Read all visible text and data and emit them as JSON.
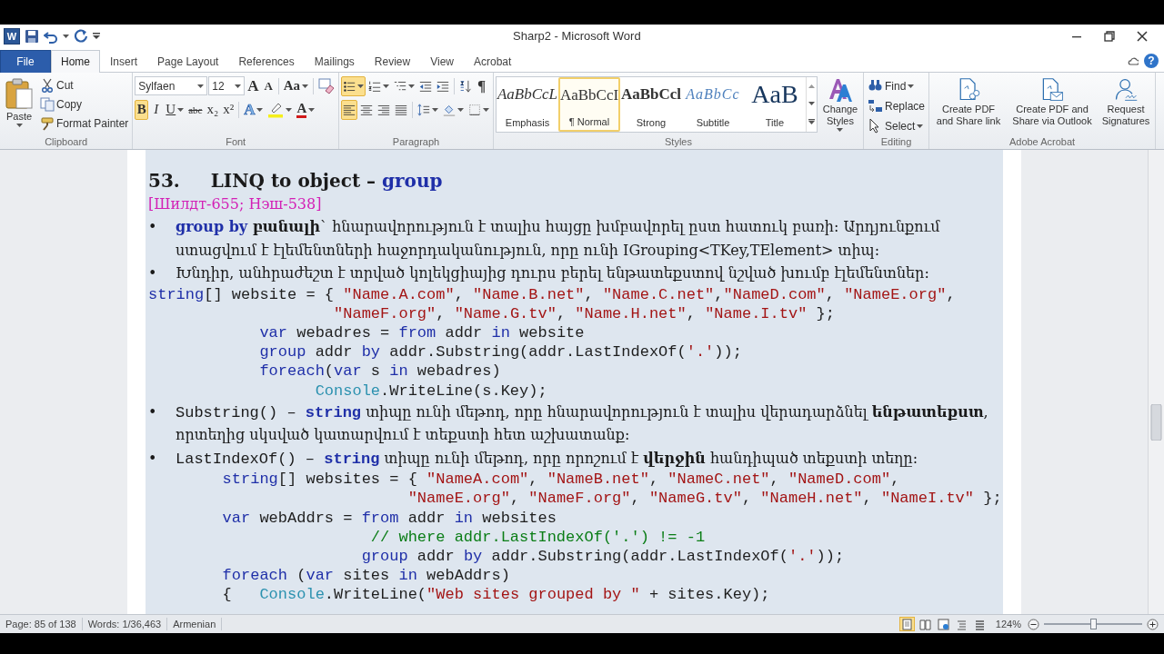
{
  "window": {
    "title": "Sharp2 - Microsoft Word",
    "app_icon_letter": "W",
    "help": "?"
  },
  "tabs": [
    {
      "label": "File",
      "kind": "file",
      "selected": false
    },
    {
      "label": "Home",
      "kind": "tab",
      "selected": true
    },
    {
      "label": "Insert",
      "kind": "tab",
      "selected": false
    },
    {
      "label": "Page Layout",
      "kind": "tab",
      "selected": false
    },
    {
      "label": "References",
      "kind": "tab",
      "selected": false
    },
    {
      "label": "Mailings",
      "kind": "tab",
      "selected": false
    },
    {
      "label": "Review",
      "kind": "tab",
      "selected": false
    },
    {
      "label": "View",
      "kind": "tab",
      "selected": false
    },
    {
      "label": "Acrobat",
      "kind": "tab",
      "selected": false
    }
  ],
  "ribbon": {
    "clipboard": {
      "label": "Clipboard",
      "paste": "Paste",
      "items": [
        {
          "label": "Cut",
          "kind": "cut"
        },
        {
          "label": "Copy",
          "kind": "copy"
        },
        {
          "label": "Format Painter",
          "kind": "painter"
        }
      ]
    },
    "font": {
      "label": "Font",
      "font_name": "Sylfaen",
      "font_size": "12",
      "grow": "A",
      "shrink": "A",
      "change_case": "Aa",
      "buttons": [
        {
          "label": "B",
          "kind": "bold",
          "on": true
        },
        {
          "label": "I",
          "kind": "italic",
          "on": false
        },
        {
          "label": "U",
          "kind": "underline",
          "on": false
        },
        {
          "label": "abc",
          "kind": "strike",
          "on": false
        },
        {
          "label": "x₂",
          "kind": "sub",
          "on": false
        },
        {
          "label": "x²",
          "kind": "sup",
          "on": false
        }
      ],
      "text_effects": "A",
      "font_color": "A"
    },
    "paragraph": {
      "label": "Paragraph",
      "rows": [
        [
          {
            "kind": "bullets",
            "on": true
          },
          {
            "kind": "numbering",
            "on": false
          },
          {
            "kind": "multilevel",
            "on": false
          },
          {
            "kind": "indent-decrease",
            "on": false
          },
          {
            "kind": "indent-increase",
            "on": false
          },
          {
            "kind": "sort",
            "on": false
          },
          {
            "kind": "marks",
            "label": "¶",
            "on": false
          }
        ],
        [
          {
            "kind": "align-left",
            "on": true
          },
          {
            "kind": "align-center",
            "on": false
          },
          {
            "kind": "align-right",
            "on": false
          },
          {
            "kind": "justify",
            "on": false
          },
          {
            "kind": "line-spacing",
            "on": false
          },
          {
            "kind": "shading",
            "on": false
          },
          {
            "kind": "borders",
            "on": false
          }
        ]
      ]
    },
    "styles": {
      "label": "Styles",
      "change_styles": "Change Styles",
      "gallery": [
        {
          "sample": "AaBbCcL",
          "name": "Emphasis",
          "kind": "emphasis",
          "selected": false
        },
        {
          "sample": "AaBbCcI",
          "name": "¶ Normal",
          "kind": "normal",
          "selected": true
        },
        {
          "sample": "AaBbCcl",
          "name": "Strong",
          "kind": "strong",
          "selected": false
        },
        {
          "sample": "AaBbCc",
          "name": "Subtitle",
          "kind": "subtitle",
          "selected": false
        },
        {
          "sample": "AaB",
          "name": "Title",
          "kind": "title",
          "selected": false
        }
      ]
    },
    "editing": {
      "label": "Editing",
      "items": [
        {
          "label": "Find",
          "kind": "find"
        },
        {
          "label": "Replace",
          "kind": "replace"
        },
        {
          "label": "Select",
          "kind": "select"
        }
      ]
    },
    "acrobat": {
      "label": "Adobe Acrobat",
      "items": [
        {
          "label": "Create PDF and Share link",
          "kind": "share-link"
        },
        {
          "label": "Create PDF and Share via Outlook",
          "kind": "share-mail"
        },
        {
          "label": "Request Signatures",
          "kind": "signature"
        }
      ]
    }
  },
  "document": {
    "heading": {
      "number": "53.",
      "segments": [
        {
          "text": "LINQ  to object – ",
          "kind": "plain"
        },
        {
          "text": "group",
          "kind": "keyword"
        }
      ]
    },
    "reference": "[Шилдт-655; Нэш-538]",
    "blocks": [
      {
        "kind": "bullet",
        "bullet": "•",
        "segments": [
          {
            "text": "group  by",
            "kind": "keyword"
          },
          {
            "text": " բանալի",
            "kind": "bold"
          },
          {
            "text": "` հնարավորություն է տալիս հայցը խմբավորել ըստ հատուկ բառի։ Արդյունքում ստացվում է էլեմենտների հաջորդականություն, որը ունի IGrouping<TKey,TElement> տիպ։",
            "kind": "plain"
          }
        ]
      },
      {
        "kind": "bullet",
        "bullet": "•",
        "segments": [
          {
            "text": "Խնդիր, անհրաժեշտ է տրված կոլեկցիայից դուրս բերել ենթատեքստով նշված խումբ էլեմենտներ։",
            "kind": "plain"
          }
        ]
      },
      {
        "kind": "code",
        "lines": [
          [
            {
              "text": "string",
              "kind": "keyword"
            },
            {
              "text": "[] website = { ",
              "kind": "plain"
            },
            {
              "text": "\"Name.A.com\"",
              "kind": "string"
            },
            {
              "text": ", ",
              "kind": "plain"
            },
            {
              "text": "\"Name.B.net\"",
              "kind": "string"
            },
            {
              "text": ", ",
              "kind": "plain"
            },
            {
              "text": "\"Name.C.net\"",
              "kind": "string"
            },
            {
              "text": ",",
              "kind": "plain"
            },
            {
              "text": "\"NameD.com\"",
              "kind": "string"
            },
            {
              "text": ", ",
              "kind": "plain"
            },
            {
              "text": "\"NameE.org\"",
              "kind": "string"
            },
            {
              "text": ",",
              "kind": "plain"
            }
          ],
          [
            {
              "text": "                    \"NameF.org\"",
              "kind": "string"
            },
            {
              "text": ", ",
              "kind": "plain"
            },
            {
              "text": "\"Name.G.tv\"",
              "kind": "string"
            },
            {
              "text": ", ",
              "kind": "plain"
            },
            {
              "text": "\"Name.H.net\"",
              "kind": "string"
            },
            {
              "text": ", ",
              "kind": "plain"
            },
            {
              "text": "\"Name.I.tv\"",
              "kind": "string"
            },
            {
              "text": " };",
              "kind": "plain"
            }
          ],
          [
            {
              "text": "            var",
              "kind": "keyword"
            },
            {
              "text": " webadres = ",
              "kind": "plain"
            },
            {
              "text": "from",
              "kind": "keyword"
            },
            {
              "text": " addr ",
              "kind": "plain"
            },
            {
              "text": "in",
              "kind": "keyword"
            },
            {
              "text": " website",
              "kind": "plain"
            }
          ],
          [
            {
              "text": "            group",
              "kind": "keyword"
            },
            {
              "text": " addr ",
              "kind": "plain"
            },
            {
              "text": "by",
              "kind": "keyword"
            },
            {
              "text": " addr.Substring(addr.LastIndexOf(",
              "kind": "plain"
            },
            {
              "text": "'.'",
              "kind": "string"
            },
            {
              "text": "));",
              "kind": "plain"
            }
          ],
          [
            {
              "text": "            foreach",
              "kind": "keyword"
            },
            {
              "text": "(",
              "kind": "plain"
            },
            {
              "text": "var",
              "kind": "keyword"
            },
            {
              "text": " s ",
              "kind": "plain"
            },
            {
              "text": "in",
              "kind": "keyword"
            },
            {
              "text": " webadres)",
              "kind": "plain"
            }
          ],
          [
            {
              "text": "                  Console",
              "kind": "type"
            },
            {
              "text": ".WriteLine(s.Key);",
              "kind": "plain"
            }
          ]
        ]
      },
      {
        "kind": "bullet",
        "bullet": "•",
        "segments": [
          {
            "text": "Substring() – ",
            "kind": "code"
          },
          {
            "text": "string",
            "kind": "code-keyword"
          },
          {
            "text": " տիպը ունի մեթոդ, որը հնարավորություն է տալիս վերադարձնել ",
            "kind": "plain"
          },
          {
            "text": "ենթատեքստ",
            "kind": "bold"
          },
          {
            "text": ", որտեղից սկսված կատարվում է տեքստի հետ աշխատանք։",
            "kind": "plain"
          }
        ]
      },
      {
        "kind": "bullet",
        "bullet": "•",
        "segments": [
          {
            "text": "LastIndexOf() – ",
            "kind": "code"
          },
          {
            "text": "string",
            "kind": "code-keyword"
          },
          {
            "text": " տիպը ունի մեթոդ, որը որոշում է ",
            "kind": "plain"
          },
          {
            "text": "վերջին",
            "kind": "bold"
          },
          {
            "text": " հանդիպած տեքստի տեղը։",
            "kind": "plain"
          }
        ]
      },
      {
        "kind": "code",
        "lines": [
          [
            {
              "text": "        string",
              "kind": "keyword"
            },
            {
              "text": "[] websites = { ",
              "kind": "plain"
            },
            {
              "text": "\"NameA.com\"",
              "kind": "string"
            },
            {
              "text": ", ",
              "kind": "plain"
            },
            {
              "text": "\"NameB.net\"",
              "kind": "string"
            },
            {
              "text": ", ",
              "kind": "plain"
            },
            {
              "text": "\"NameC.net\"",
              "kind": "string"
            },
            {
              "text": ", ",
              "kind": "plain"
            },
            {
              "text": "\"NameD.com\"",
              "kind": "string"
            },
            {
              "text": ",",
              "kind": "plain"
            }
          ],
          [
            {
              "text": "                            \"NameE.org\"",
              "kind": "string"
            },
            {
              "text": ", ",
              "kind": "plain"
            },
            {
              "text": "\"NameF.org\"",
              "kind": "string"
            },
            {
              "text": ", ",
              "kind": "plain"
            },
            {
              "text": "\"NameG.tv\"",
              "kind": "string"
            },
            {
              "text": ", ",
              "kind": "plain"
            },
            {
              "text": "\"NameH.net\"",
              "kind": "string"
            },
            {
              "text": ", ",
              "kind": "plain"
            },
            {
              "text": "\"NameI.tv\"",
              "kind": "string"
            },
            {
              "text": " };",
              "kind": "plain"
            }
          ],
          [
            {
              "text": "        var",
              "kind": "keyword"
            },
            {
              "text": " webAddrs = ",
              "kind": "plain"
            },
            {
              "text": "from",
              "kind": "keyword"
            },
            {
              "text": " addr ",
              "kind": "plain"
            },
            {
              "text": "in",
              "kind": "keyword"
            },
            {
              "text": " websites",
              "kind": "plain"
            }
          ],
          [
            {
              "text": "                        // where addr.LastIndexOf('.') != -1",
              "kind": "comment"
            }
          ],
          [
            {
              "text": "                       group",
              "kind": "keyword"
            },
            {
              "text": " addr ",
              "kind": "plain"
            },
            {
              "text": "by",
              "kind": "keyword"
            },
            {
              "text": " addr.Substring(addr.LastIndexOf(",
              "kind": "plain"
            },
            {
              "text": "'.'",
              "kind": "string"
            },
            {
              "text": "));",
              "kind": "plain"
            }
          ],
          [
            {
              "text": "        foreach",
              "kind": "keyword"
            },
            {
              "text": " (",
              "kind": "plain"
            },
            {
              "text": "var",
              "kind": "keyword"
            },
            {
              "text": " sites ",
              "kind": "plain"
            },
            {
              "text": "in",
              "kind": "keyword"
            },
            {
              "text": " webAddrs)",
              "kind": "plain"
            }
          ],
          [
            {
              "text": "        {   ",
              "kind": "plain"
            },
            {
              "text": "Console",
              "kind": "type"
            },
            {
              "text": ".WriteLine(",
              "kind": "plain"
            },
            {
              "text": "\"Web sites grouped by \"",
              "kind": "string"
            },
            {
              "text": " + sites.Key);",
              "kind": "plain"
            }
          ]
        ]
      }
    ]
  },
  "status_bar": {
    "page": "Page: 85 of 138",
    "words": "Words: 1/36,463",
    "language": "Armenian",
    "views": [
      {
        "kind": "print-layout",
        "selected": true
      },
      {
        "kind": "full-screen",
        "selected": false
      },
      {
        "kind": "web",
        "selected": false
      },
      {
        "kind": "outline",
        "selected": false
      },
      {
        "kind": "draft",
        "selected": false
      }
    ],
    "zoom": {
      "reading": "124%",
      "level": 0.5
    }
  }
}
